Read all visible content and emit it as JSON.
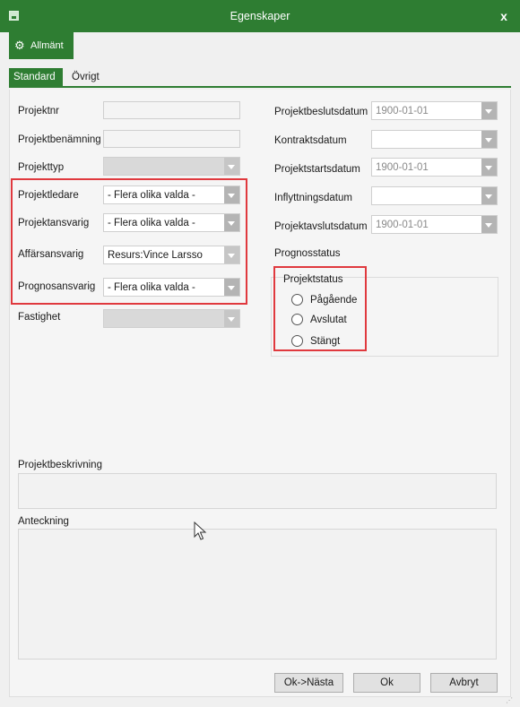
{
  "window": {
    "title": "Egenskaper",
    "close_glyph": "x",
    "app_icon": "app-icon"
  },
  "tabs": {
    "main": {
      "label": "Allmänt",
      "icon": "gear-icon"
    },
    "sub": [
      {
        "label": "Standard",
        "active": true
      },
      {
        "label": "Övrigt",
        "active": false
      }
    ]
  },
  "left_fields": {
    "projektnr": {
      "label": "Projektnr",
      "value": ""
    },
    "projektbenamning": {
      "label": "Projektbenämning",
      "value": ""
    },
    "projekttyp": {
      "label": "Projekttyp",
      "value": ""
    },
    "projektledare": {
      "label": "Projektledare",
      "value": "- Flera olika valda -"
    },
    "projektansvarig": {
      "label": "Projektansvarig",
      "value": "- Flera olika valda -"
    },
    "affarsansvarig": {
      "label": "Affärsansvarig",
      "value": "Resurs:Vince Larsso"
    },
    "prognosansvarig": {
      "label": "Prognosansvarig",
      "value": "- Flera olika valda -"
    },
    "fastighet": {
      "label": "Fastighet",
      "value": ""
    }
  },
  "right_fields": {
    "projektbeslutsdatum": {
      "label": "Projektbeslutsdatum",
      "value": "1900-01-01"
    },
    "kontraktsdatum": {
      "label": "Kontraktsdatum",
      "value": ""
    },
    "projektstartsdatum": {
      "label": "Projektstartsdatum",
      "value": "1900-01-01"
    },
    "inflyttningsdatum": {
      "label": "Inflyttningsdatum",
      "value": ""
    },
    "projektavslutsdatum": {
      "label": "Projektavslutsdatum",
      "value": "1900-01-01"
    },
    "prognosstatus": {
      "label": "Prognosstatus"
    }
  },
  "projektstatus": {
    "label": "Projektstatus",
    "options": [
      {
        "label": "Pågående",
        "checked": false
      },
      {
        "label": "Avslutat",
        "checked": false
      },
      {
        "label": "Stängt",
        "checked": false
      }
    ]
  },
  "beskrivning": {
    "label": "Projektbeskrivning",
    "value": ""
  },
  "anteckning": {
    "label": "Anteckning",
    "value": ""
  },
  "buttons": {
    "ok_next": "Ok->Nästa",
    "ok": "Ok",
    "cancel": "Avbryt"
  },
  "colors": {
    "accent": "#2e7d32",
    "highlight": "#e0393e"
  }
}
